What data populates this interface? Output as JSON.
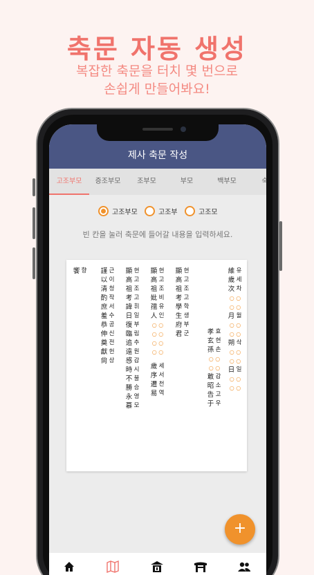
{
  "promo": {
    "title": "축문 자동 생성",
    "subtitle_line1": "복잡한 축문을 터치 몇 번으로",
    "subtitle_line2": "손쉽게 만들어봐요!"
  },
  "app": {
    "title": "제사 축문 작성"
  },
  "tabs": [
    {
      "label": "고조부모",
      "active": true
    },
    {
      "label": "증조부모",
      "active": false
    },
    {
      "label": "조부모",
      "active": false
    },
    {
      "label": "부모",
      "active": false
    },
    {
      "label": "백부모",
      "active": false
    },
    {
      "label": "숙",
      "active": false
    }
  ],
  "radios": [
    {
      "label": "고조부모",
      "selected": true
    },
    {
      "label": "고조부",
      "selected": false
    },
    {
      "label": "고조모",
      "selected": false
    }
  ],
  "instruction": "빈 칸을 눌러 축문에 들어갈 내용을 입력하세요.",
  "document": {
    "columns": [
      [
        {
          "h": "維",
          "k": "유"
        },
        {
          "h": "歲",
          "k": "세"
        },
        {
          "h": "次",
          "k": "차"
        },
        {
          "blank": "○ ○"
        },
        {
          "blank": "○ ○"
        },
        {
          "h": "月",
          "k": "월"
        },
        {
          "blank": "○ ○"
        },
        {
          "blank": "○ ○"
        },
        {
          "h": "朔",
          "k": "삭"
        },
        {
          "blank": "○ ○"
        },
        {
          "blank": "○ ○"
        },
        {
          "h": "日",
          "k": "일"
        },
        {
          "blank": "○ ○"
        },
        {
          "blank": "○ ○"
        }
      ],
      [
        {
          "gap": true
        },
        {
          "gap": true
        },
        {
          "gap": true
        },
        {
          "gap": true
        },
        {
          "gap": true
        },
        {
          "gap": true
        },
        {
          "gap": true
        },
        {
          "gap": true
        },
        {
          "gap": true
        },
        {
          "gap": true
        },
        {
          "gap": true
        },
        {
          "h": "孝",
          "k": "효"
        },
        {
          "h": "玄",
          "k": "현"
        },
        {
          "h": "孫",
          "k": "손"
        },
        {
          "blank": "○ ○"
        },
        {
          "blank": "○ ○"
        },
        {
          "h": "敢",
          "k": "감"
        },
        {
          "h": "昭",
          "k": "소"
        },
        {
          "h": "告",
          "k": "고"
        },
        {
          "h": "于",
          "k": "우"
        }
      ],
      [
        {
          "h": "顯",
          "k": "현"
        },
        {
          "h": "高",
          "k": "고"
        },
        {
          "h": "祖",
          "k": "조"
        },
        {
          "h": "考",
          "k": "고"
        },
        {
          "h": "學",
          "k": "학"
        },
        {
          "h": "生",
          "k": "생"
        },
        {
          "h": "府",
          "k": "부"
        },
        {
          "h": "君",
          "k": "군"
        }
      ],
      [
        {
          "h": "顯",
          "k": "현"
        },
        {
          "h": "高",
          "k": "고"
        },
        {
          "h": "祖",
          "k": "조"
        },
        {
          "h": "妣",
          "k": "비"
        },
        {
          "h": "孺",
          "k": "유"
        },
        {
          "h": "人",
          "k": "인"
        },
        {
          "blank": "○ ○"
        },
        {
          "blank": "○ ○"
        },
        {
          "blank": "○ ○"
        },
        {
          "blank": "○ ○"
        },
        {
          "gap": true
        },
        {
          "h": "歲",
          "k": "세"
        },
        {
          "h": "序",
          "k": "서"
        },
        {
          "h": "遷",
          "k": "천"
        },
        {
          "h": "易",
          "k": "역"
        }
      ],
      [
        {
          "h": "顯",
          "k": "현"
        },
        {
          "h": "高",
          "k": "고"
        },
        {
          "h": "祖",
          "k": "조"
        },
        {
          "h": "考",
          "k": "고"
        },
        {
          "h": "諱",
          "k": "휘"
        },
        {
          "h": "日",
          "k": "일"
        },
        {
          "h": "復",
          "k": "부"
        },
        {
          "h": "臨",
          "k": "림"
        },
        {
          "h": "追",
          "k": "추"
        },
        {
          "h": "遠",
          "k": "원"
        },
        {
          "h": "感",
          "k": "감"
        },
        {
          "h": "時",
          "k": "시"
        },
        {
          "h": "不",
          "k": "불"
        },
        {
          "h": "勝",
          "k": "승"
        },
        {
          "h": "永",
          "k": "영"
        },
        {
          "h": "慕",
          "k": "모"
        }
      ],
      [
        {
          "h": "謹",
          "k": "근"
        },
        {
          "h": "以",
          "k": "이"
        },
        {
          "h": "清",
          "k": "청"
        },
        {
          "h": "酌",
          "k": "작"
        },
        {
          "h": "庶",
          "k": "서"
        },
        {
          "h": "羞",
          "k": "수"
        },
        {
          "h": "恭",
          "k": "공"
        },
        {
          "h": "伸",
          "k": "신"
        },
        {
          "h": "奠",
          "k": "전"
        },
        {
          "h": "獻",
          "k": "헌"
        },
        {
          "h": "尙",
          "k": "상"
        }
      ],
      [
        {
          "h": "饗",
          "k": "향"
        }
      ]
    ]
  },
  "fab": {
    "label": "+"
  },
  "nav_icons": [
    "home-icon",
    "map-icon",
    "shrine-icon",
    "gate-icon",
    "people-icon"
  ]
}
